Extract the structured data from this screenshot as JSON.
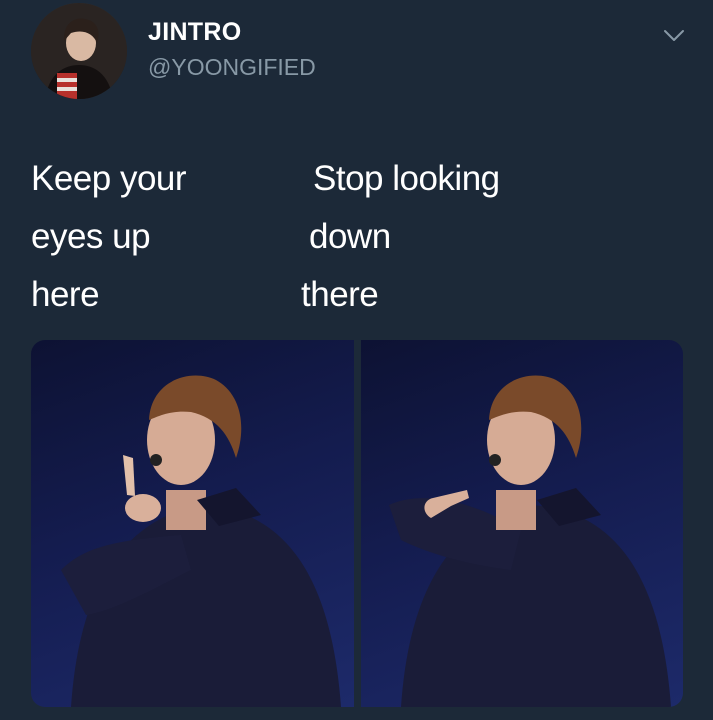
{
  "tweet": {
    "display_name": "JINTRO",
    "handle": "@YOONGIFIED",
    "left_text_lines": [
      "Keep your",
      "eyes up",
      "here"
    ],
    "right_text_lines": [
      "Stop looking",
      "down",
      "there"
    ]
  },
  "icons": {
    "chevron": "chevron-down-icon"
  },
  "colors": {
    "background": "#1c2938",
    "text": "#ffffff",
    "handle": "#8899a6"
  }
}
